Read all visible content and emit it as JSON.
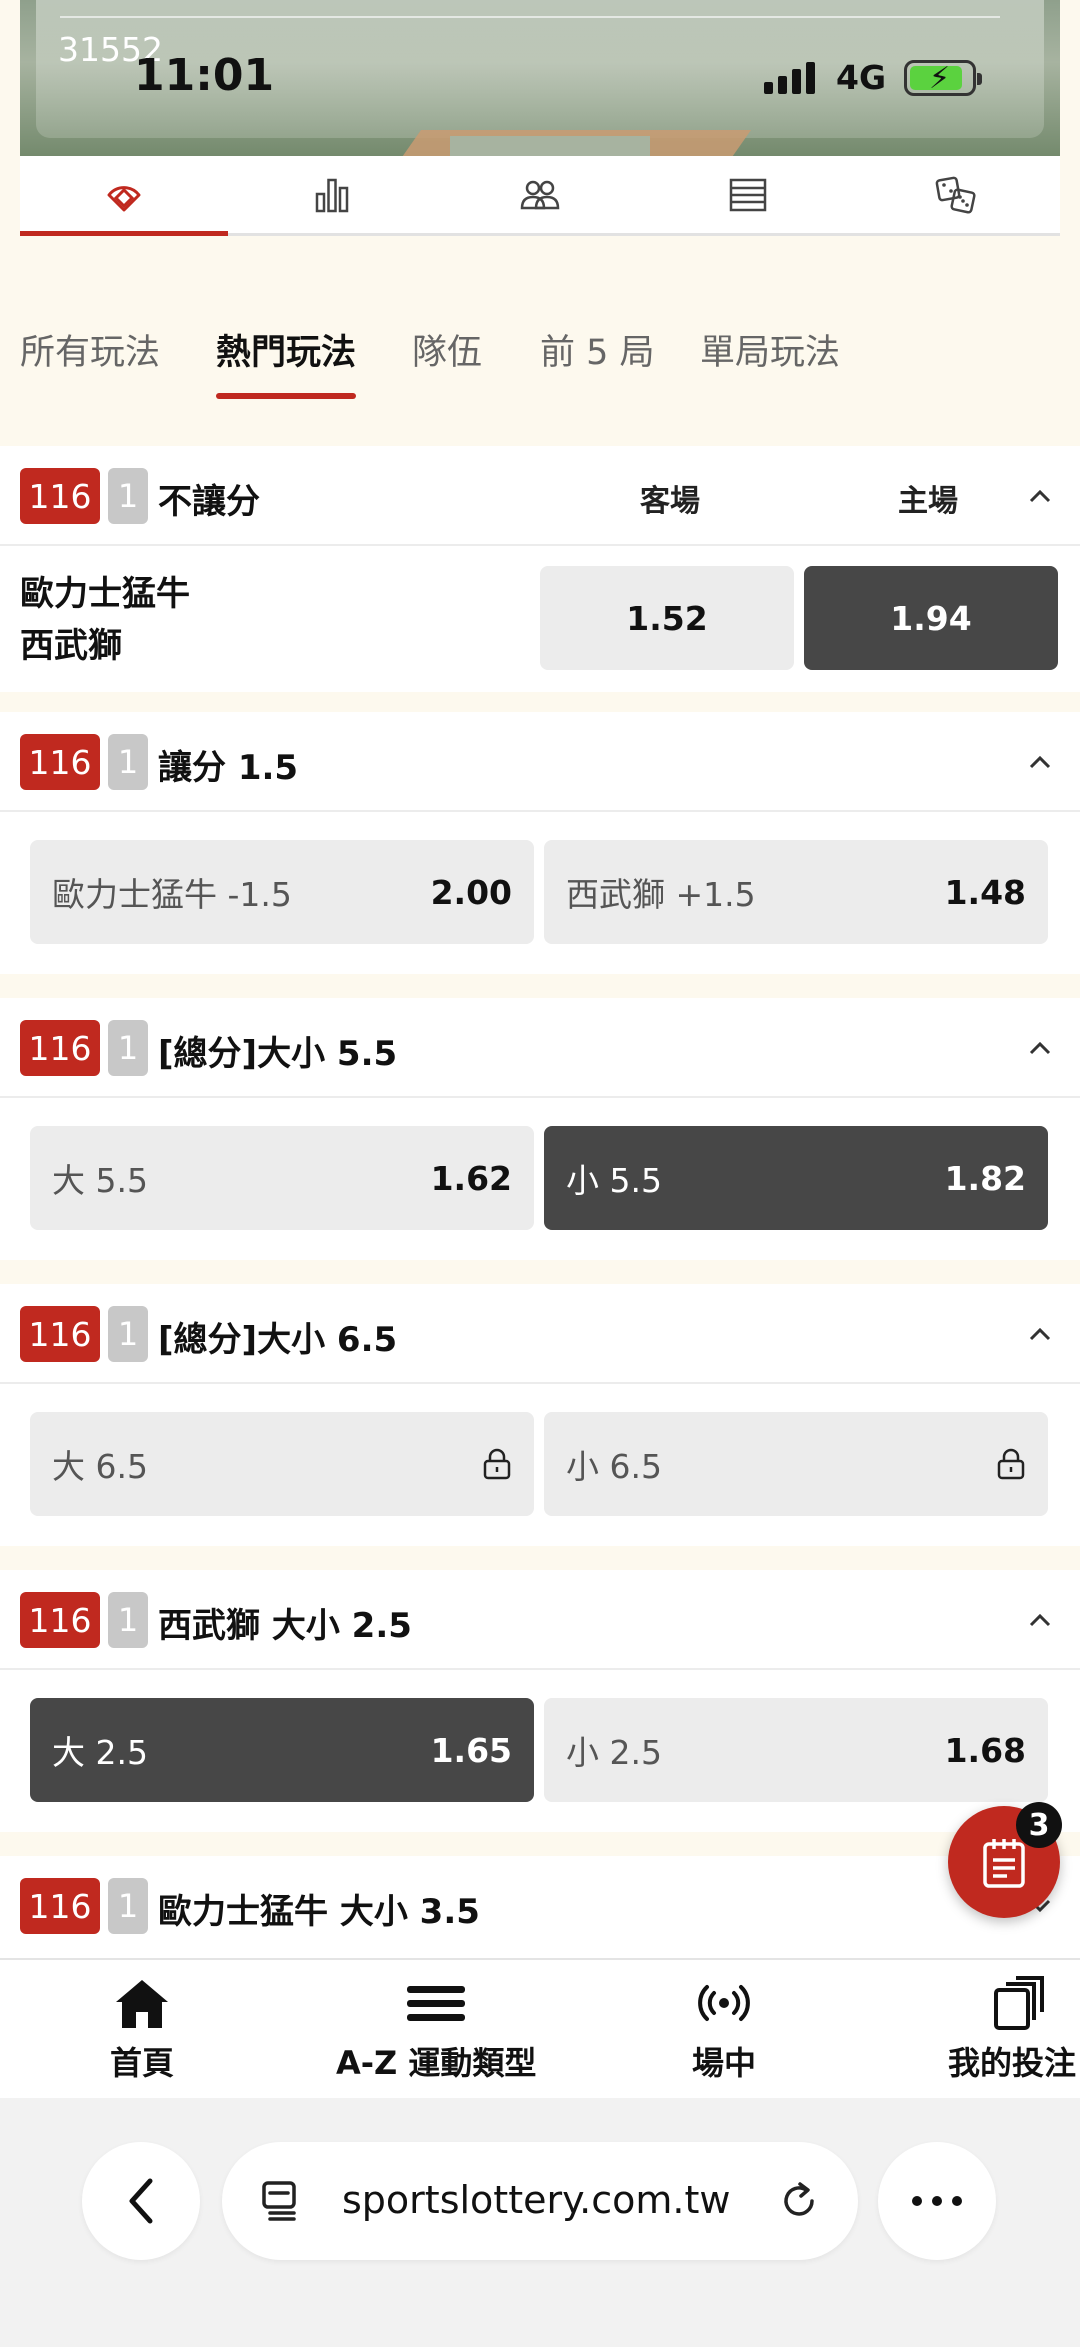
{
  "status_bar": {
    "game_id": "31552",
    "time": "11:01",
    "network": "4G"
  },
  "icon_tabs": [
    "baseball-field-icon",
    "stats-bar-icon",
    "team-users-icon",
    "list-table-icon",
    "dice-icon"
  ],
  "colors": {
    "accent": "#c0291f",
    "selected_odd": "#474747",
    "odd_bg": "#ececec",
    "page_bg": "#fdf9ee"
  },
  "text_tabs": [
    {
      "label": "所有玩法",
      "active": false
    },
    {
      "label": "熱門玩法",
      "active": true
    },
    {
      "label": "隊伍",
      "active": false
    },
    {
      "label": "前 5 局",
      "active": false
    },
    {
      "label": "單局玩法",
      "active": false
    }
  ],
  "markets": [
    {
      "num": "116",
      "idx": "1",
      "title": "不讓分",
      "col_away": "客場",
      "col_home": "主場",
      "team_away": "歐力士猛牛",
      "team_home": "西武獅",
      "odds": [
        {
          "value": "1.52",
          "selected": false
        },
        {
          "value": "1.94",
          "selected": true
        }
      ]
    },
    {
      "num": "116",
      "idx": "1",
      "title": "讓分 1.5",
      "odds": [
        {
          "label": "歐力士猛牛 -1.5",
          "value": "2.00",
          "selected": false
        },
        {
          "label": "西武獅 +1.5",
          "value": "1.48",
          "selected": false
        }
      ]
    },
    {
      "num": "116",
      "idx": "1",
      "title": "[總分]大小 5.5",
      "odds": [
        {
          "label": "大 5.5",
          "value": "1.62",
          "selected": false
        },
        {
          "label": "小 5.5",
          "value": "1.82",
          "selected": true
        }
      ]
    },
    {
      "num": "116",
      "idx": "1",
      "title": "[總分]大小 6.5",
      "odds": [
        {
          "label": "大 6.5",
          "locked": true
        },
        {
          "label": "小 6.5",
          "locked": true
        }
      ]
    },
    {
      "num": "116",
      "idx": "1",
      "title": "西武獅 大小 2.5",
      "odds": [
        {
          "label": "大 2.5",
          "value": "1.65",
          "selected": true
        },
        {
          "label": "小 2.5",
          "value": "1.68",
          "selected": false
        }
      ]
    },
    {
      "num": "116",
      "idx": "1",
      "title": "歐力士猛牛 大小 3.5"
    }
  ],
  "bet_slip": {
    "count": "3"
  },
  "bottom_nav": {
    "home": "首頁",
    "sports": "A-Z 運動類型",
    "live": "場中",
    "my_bets": "我的投注"
  },
  "browser": {
    "url": "sportslottery.com.tw"
  }
}
